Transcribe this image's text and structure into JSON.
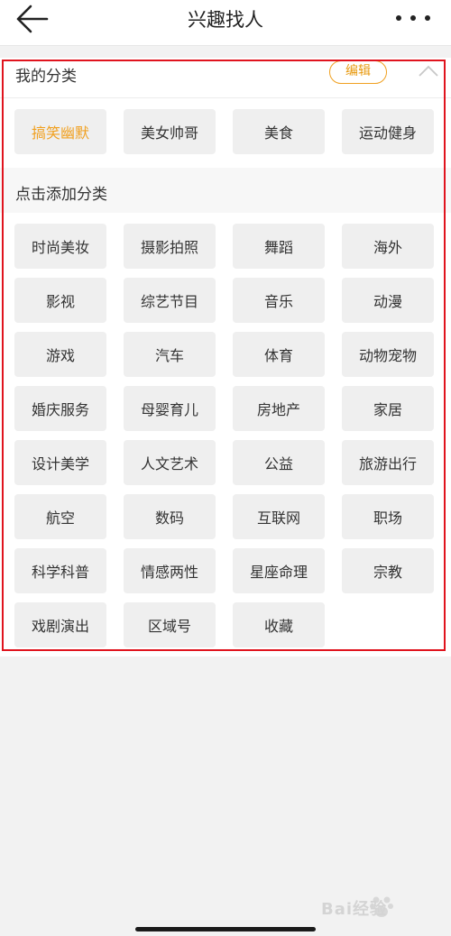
{
  "header": {
    "title": "兴趣找人",
    "back_icon": "back-arrow-icon",
    "more_icon": "more-dots-icon"
  },
  "my_categories": {
    "title": "我的分类",
    "edit_label": "编辑",
    "accent_color": "#f0a020",
    "tags": [
      {
        "label": "搞笑幽默",
        "active": true
      },
      {
        "label": "美女帅哥",
        "active": false
      },
      {
        "label": "美食",
        "active": false
      },
      {
        "label": "运动健身",
        "active": false
      }
    ]
  },
  "add_categories": {
    "title": "点击添加分类",
    "tags": [
      "时尚美妆",
      "摄影拍照",
      "舞蹈",
      "海外",
      "影视",
      "综艺节目",
      "音乐",
      "动漫",
      "游戏",
      "汽车",
      "体育",
      "动物宠物",
      "婚庆服务",
      "母婴育儿",
      "房地产",
      "家居",
      "设计美学",
      "人文艺术",
      "公益",
      "旅游出行",
      "航空",
      "数码",
      "互联网",
      "职场",
      "科学科普",
      "情感两性",
      "星座命理",
      "宗教",
      "戏剧演出",
      "区域号",
      "收藏"
    ]
  },
  "watermark": {
    "text": "Bai经验"
  }
}
